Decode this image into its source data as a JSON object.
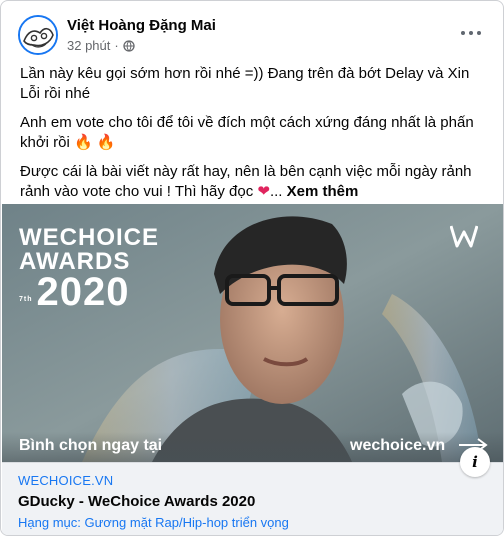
{
  "post": {
    "author": "Việt Hoàng Đặng Mai",
    "time": "32 phút",
    "separator": "·",
    "privacy_icon": "globe-icon",
    "more_icon": "more-options-icon",
    "paragraphs": [
      "Lần này kêu gọi sớm hơn rồi nhé =)) Đang trên đà bớt Delay và Xin Lỗi rồi nhé",
      "Anh em vote cho tôi để tôi về đích một cách xứng đáng nhất là phấn khởi rồi",
      "Được cái là bài viết này rất hay, nên là bên cạnh việc mỗi ngày rảnh rảnh vào vote cho vui ! Thì hãy đọc"
    ],
    "fire_emoji": "🔥",
    "heart_emoji": "❤",
    "ellipsis": "...",
    "see_more": "Xem thêm"
  },
  "media": {
    "logo_line1": "WECHOICE",
    "logo_line2": "AWARDS",
    "logo_sup": "7th",
    "logo_year": "2020",
    "cta_left": "Bình chọn ngay tại",
    "cta_right": "wechoice.vn",
    "arrow_icon": "arrow-right-icon"
  },
  "link_preview": {
    "domain": "WECHOICE.VN",
    "title": "GDucky - WeChoice Awards 2020",
    "description": "Hạng mục: Gương mặt Rap/Hip-hop triển vọng",
    "info_label": "i"
  },
  "colors": {
    "accent": "#1877f2",
    "text": "#050505",
    "secondary": "#65676b",
    "link_bg": "#f0f2f5"
  }
}
